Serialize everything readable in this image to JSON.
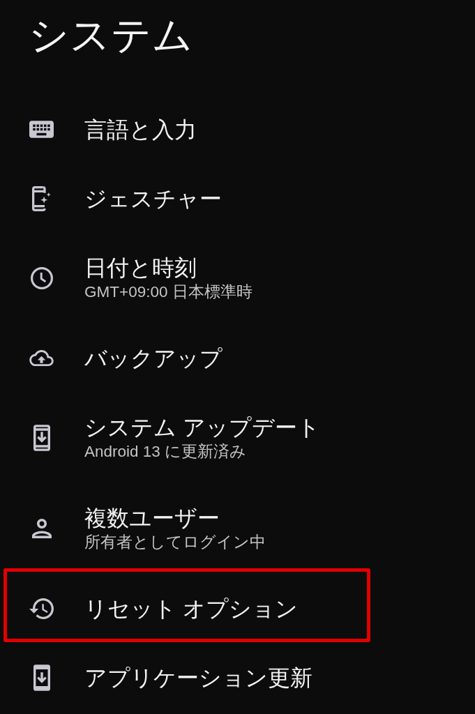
{
  "title": "システム",
  "items": [
    {
      "title": "言語と入力",
      "highlighted": false
    },
    {
      "title": "ジェスチャー",
      "highlighted": false
    },
    {
      "title": "日付と時刻",
      "subtitle": "GMT+09:00 日本標準時",
      "highlighted": false
    },
    {
      "title": "バックアップ",
      "highlighted": false
    },
    {
      "title": "システム アップデート",
      "subtitle": "Android 13 に更新済み",
      "highlighted": false
    },
    {
      "title": "複数ユーザー",
      "subtitle": "所有者としてログイン中",
      "highlighted": false
    },
    {
      "title": "リセット オプション",
      "highlighted": true
    },
    {
      "title": "アプリケーション更新",
      "highlighted": false
    }
  ]
}
